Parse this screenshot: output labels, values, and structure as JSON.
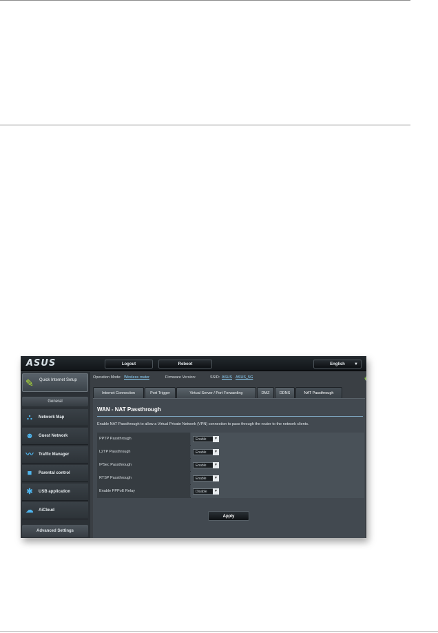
{
  "header": {
    "logo": "ASUS",
    "logout_label": "Logout",
    "reboot_label": "Reboot",
    "language": "English"
  },
  "sidebar": {
    "quick_setup_label": "Quick Internet Setup",
    "general_heading": "General",
    "items": [
      {
        "label": "Network Map",
        "icon": "network-map-icon"
      },
      {
        "label": "Guest Network",
        "icon": "guest-network-icon"
      },
      {
        "label": "Traffic Manager",
        "icon": "traffic-manager-icon"
      },
      {
        "label": "Parental control",
        "icon": "parental-control-icon"
      },
      {
        "label": "USB application",
        "icon": "usb-application-icon"
      },
      {
        "label": "AiCloud",
        "icon": "aicloud-icon"
      }
    ],
    "advanced_heading": "Advanced Settings"
  },
  "status": {
    "op_mode_label": "Operation Mode:",
    "op_mode_value": "Wireless router",
    "firmware_label": "Firmware Version:",
    "ssid_label": "SSID:",
    "ssid_values": [
      "ASUS",
      "ASUS_5G"
    ]
  },
  "tabs": [
    "Internet Connection",
    "Port Trigger",
    "Virtual Server / Port Forwarding",
    "DMZ",
    "DDNS",
    "NAT Passthrough"
  ],
  "panel": {
    "title": "WAN - NAT Passthrough",
    "description": "Enable NAT Passthrough to allow a Virtual Private Network (VPN) connection to pass through the router to the network clients.",
    "rows": [
      {
        "label": "PPTP Passthrough",
        "value": "Enable"
      },
      {
        "label": "L2TP Passthrough",
        "value": "Enable"
      },
      {
        "label": "IPSec Passthrough",
        "value": "Enable"
      },
      {
        "label": "RTSP Passthrough",
        "value": "Enable"
      },
      {
        "label": "Enable PPPoE Relay",
        "value": "Disable"
      }
    ],
    "apply_label": "Apply"
  },
  "colors": {
    "accent": "#4fb6ef",
    "quick_setup_icon": "#b5e833",
    "background": "#3a3f44"
  }
}
